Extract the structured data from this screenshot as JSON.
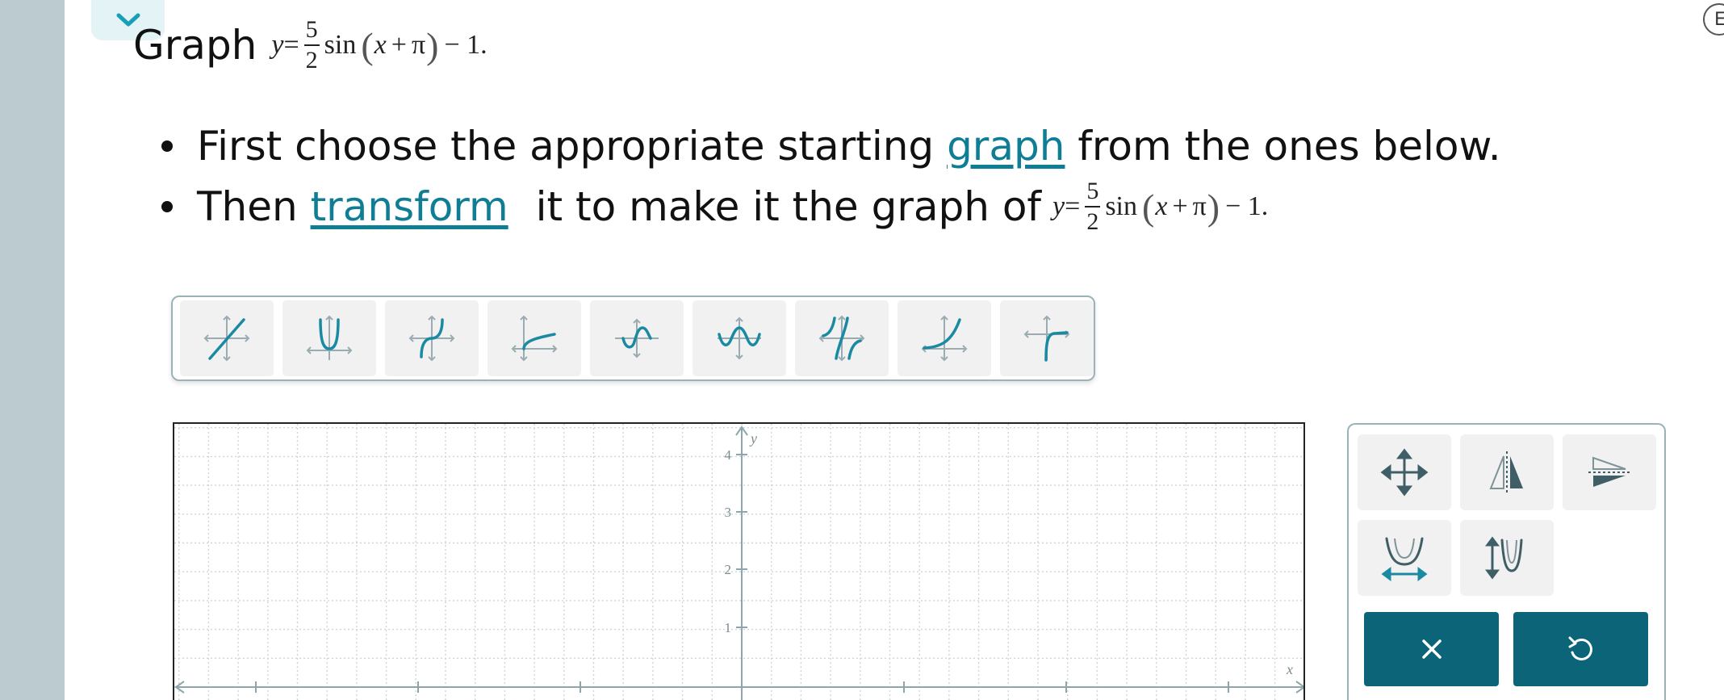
{
  "header": {
    "collapse_icon": "chevron-down-icon",
    "badge_letter": "E"
  },
  "problem": {
    "title_word": "Graph",
    "equation": {
      "lhs": "y",
      "eq": "=",
      "frac_num": "5",
      "frac_den": "2",
      "func": "sin",
      "open_paren": "(",
      "arg_var": "x",
      "arg_op": "+",
      "arg_const": "π",
      "close_paren": ")",
      "tail": "− 1."
    },
    "instructions": [
      {
        "before": "First choose the appropriate starting ",
        "link": "graph",
        "after": " from the ones below."
      },
      {
        "before": "Then ",
        "link": "transform",
        "after": " it to make it the graph of"
      }
    ]
  },
  "palette": {
    "buttons": [
      {
        "name": "linear-graph-button",
        "icon": "linear-graph-icon"
      },
      {
        "name": "absolute-value-graph-button",
        "icon": "absolute-value-graph-icon"
      },
      {
        "name": "cubic-graph-button",
        "icon": "cubic-graph-icon"
      },
      {
        "name": "square-root-graph-button",
        "icon": "square-root-graph-icon"
      },
      {
        "name": "sine-graph-button",
        "icon": "sine-graph-icon"
      },
      {
        "name": "cosine-graph-button",
        "icon": "cosine-graph-icon"
      },
      {
        "name": "tangent-graph-button",
        "icon": "tangent-graph-icon"
      },
      {
        "name": "exponential-graph-button",
        "icon": "exponential-graph-icon"
      },
      {
        "name": "reciprocal-graph-button",
        "icon": "reciprocal-graph-icon"
      }
    ]
  },
  "graph": {
    "y_axis_label": "y",
    "x_axis_label": "x",
    "y_ticks": [
      "4",
      "3",
      "2",
      "1"
    ],
    "accent": "#1a8aa3"
  },
  "tools": {
    "buttons": [
      {
        "name": "translate-tool-button",
        "icon": "move-arrows-icon"
      },
      {
        "name": "reflect-y-tool-button",
        "icon": "reflect-vertical-icon"
      },
      {
        "name": "reflect-x-tool-button",
        "icon": "reflect-horizontal-icon"
      },
      {
        "name": "horizontal-stretch-tool-button",
        "icon": "horizontal-stretch-icon"
      },
      {
        "name": "vertical-stretch-tool-button",
        "icon": "vertical-stretch-icon"
      }
    ],
    "clear_icon": "close-icon",
    "undo_icon": "undo-icon",
    "action_color": "#0b6478"
  }
}
